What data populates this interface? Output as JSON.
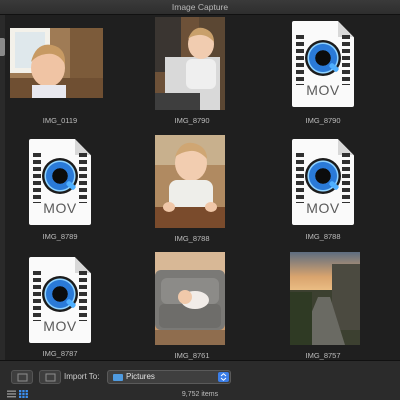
{
  "window": {
    "title": "Image Capture"
  },
  "items": [
    {
      "name": "IMG_0119",
      "kind": "photo",
      "scene": "toddler-window"
    },
    {
      "name": "IMG_8790",
      "kind": "photo",
      "scene": "toddler-highchair"
    },
    {
      "name": "IMG_8790",
      "kind": "video",
      "ext": "MOV"
    },
    {
      "name": "IMG_8789",
      "kind": "video",
      "ext": "MOV"
    },
    {
      "name": "IMG_8788",
      "kind": "photo",
      "scene": "toddler-table"
    },
    {
      "name": "IMG_8788",
      "kind": "video",
      "ext": "MOV"
    },
    {
      "name": "IMG_8787",
      "kind": "video",
      "ext": "MOV"
    },
    {
      "name": "IMG_8761",
      "kind": "photo",
      "scene": "baby-sofa"
    },
    {
      "name": "IMG_8757",
      "kind": "photo",
      "scene": "sunset-path"
    }
  ],
  "bottombar": {
    "import_label": "Import To:",
    "import_destination": "Pictures",
    "item_count": "9,752 items"
  },
  "icons": {
    "video": "quicktime-mov-file-icon",
    "folder": "folder-icon",
    "list_view": "list-view-icon",
    "grid_view": "grid-view-icon"
  },
  "colors": {
    "select_accent": "#3b7ee8",
    "folder": "#4f9be0"
  }
}
